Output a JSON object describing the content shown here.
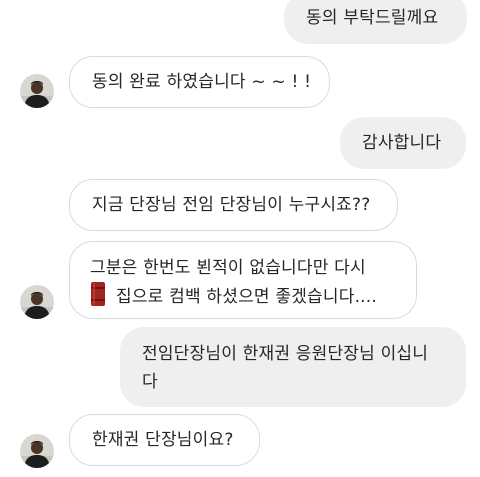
{
  "messages": [
    {
      "side": "sent",
      "lines": [
        "동의 부탁드릴께요"
      ]
    },
    {
      "side": "received",
      "lines": [
        "동의 완료 하였습니다 ~ ~ ! !"
      ]
    },
    {
      "side": "sent",
      "lines": [
        "감사합니다"
      ]
    },
    {
      "side": "received",
      "lines": [
        "지금 단장님 전임 단장님이 누구시죠??"
      ]
    },
    {
      "side": "received",
      "lines": [
        "그분은 한번도 뵌적이 없습니다만 다시",
        "집으로 컴백 하셨으면 좋겠습니다...."
      ],
      "inline_icon": "oil-barrel-emoji"
    },
    {
      "side": "sent",
      "lines": [
        "전임단장님이 한재권 응원단장님 이십니",
        "다"
      ]
    },
    {
      "side": "received",
      "lines": [
        "한재권 단장님이요?"
      ]
    }
  ],
  "colors": {
    "sent_bubble_bg": "#efefef",
    "received_bubble_border": "#dbdbdb",
    "text": "#262626",
    "barrel": "#a3231f"
  },
  "icons": {
    "avatar": "profile-photo-avatar",
    "barrel": "oil-barrel-emoji"
  }
}
